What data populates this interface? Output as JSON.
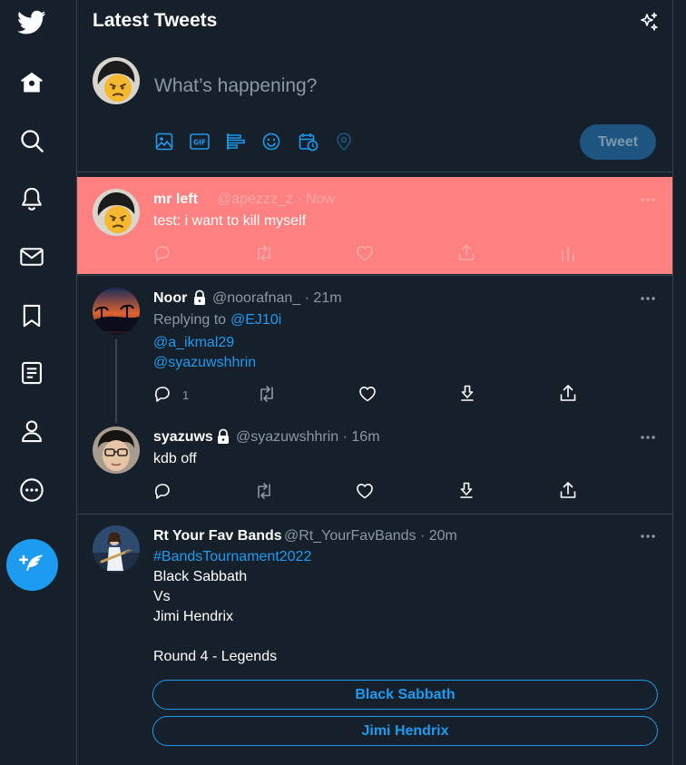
{
  "sidebar": {
    "items": [
      {
        "name": "twitter-logo-icon"
      },
      {
        "name": "home-icon"
      },
      {
        "name": "explore-icon"
      },
      {
        "name": "notifications-icon"
      },
      {
        "name": "messages-icon"
      },
      {
        "name": "bookmarks-icon"
      },
      {
        "name": "lists-icon"
      },
      {
        "name": "profile-icon"
      },
      {
        "name": "more-icon"
      }
    ],
    "compose_icon": "compose-tweet-icon"
  },
  "header": {
    "title": "Latest Tweets",
    "sparkle_icon": "sparkle-icon"
  },
  "composer": {
    "placeholder": "What’s happening?",
    "tool_icons": [
      "media-icon",
      "gif-icon",
      "poll-icon",
      "emoji-icon",
      "schedule-icon",
      "location-icon"
    ],
    "tweet_button": "Tweet"
  },
  "colors": {
    "background": "#15202b",
    "accent": "#1d9bf0",
    "highlight": "#ff8080",
    "muted": "#8b98a5",
    "border": "#38444d"
  },
  "tweets": [
    {
      "name": "mr left",
      "handle_time": "@apezzz_z · Now",
      "text": "test: i want to kill myself",
      "highlighted": true
    },
    {
      "name": "Noor",
      "handle_time": "@noorafnan_ · 21m",
      "replying_prefix": "Replying to",
      "replying_to": "@EJ10i",
      "mentions": [
        "@a_ikmal29",
        "@syazuwshhrin"
      ],
      "reply_count": "1",
      "locked": true
    },
    {
      "name": "syazuws",
      "handle_time": "@syazuwshhrin · 16m",
      "text": "kdb off",
      "locked": true
    },
    {
      "name": "Rt Your Fav Bands",
      "handle_time": "@Rt_YourFavBands · 20m",
      "hashtag": "#BandsTournament2022",
      "lines": [
        "Black Sabbath",
        "Vs",
        "Jimi Hendrix",
        "",
        "Round 4 - Legends"
      ],
      "poll_options": [
        "Black Sabbath",
        "Jimi Hendrix"
      ]
    }
  ]
}
